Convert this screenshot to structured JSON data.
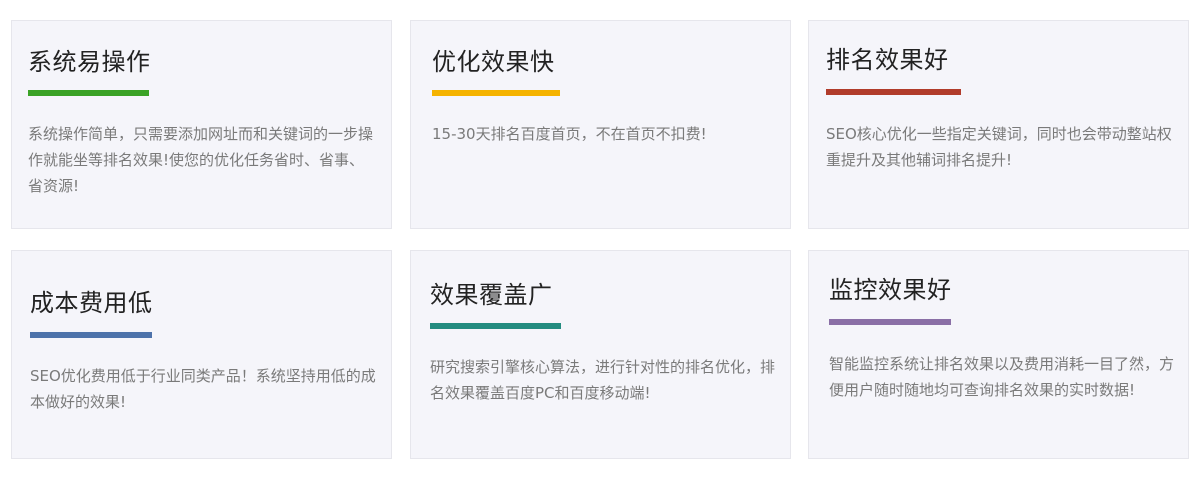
{
  "features": [
    {
      "title": "系统易操作",
      "description": "系统操作简单，只需要添加网址而和关键词的一步操作就能坐等排名效果!使您的优化任务省时、省事、省资源!",
      "accent_color": "#3aa226"
    },
    {
      "title": "优化效果快",
      "description": "15-30天排名百度首页，不在首页不扣费!",
      "accent_color": "#f5b300"
    },
    {
      "title": "排名效果好",
      "description": "SEO核心优化一些指定关键词，同时也会带动整站权重提升及其他辅词排名提升!",
      "accent_color": "#b13c2b"
    },
    {
      "title": "成本费用低",
      "description": "SEO优化费用低于行业同类产品！系统坚持用低的成本做好的效果!",
      "accent_color": "#4d72aa"
    },
    {
      "title": "效果覆盖广",
      "description": "研究搜索引擎核心算法，进行针对性的排名优化，排名效果覆盖百度PC和百度移动端!",
      "accent_color": "#248c80"
    },
    {
      "title": "监控效果好",
      "description": "智能监控系统让排名效果以及费用消耗一目了然，方便用户随时随地均可查询排名效果的实时数据!",
      "accent_color": "#8a6fa6"
    }
  ]
}
